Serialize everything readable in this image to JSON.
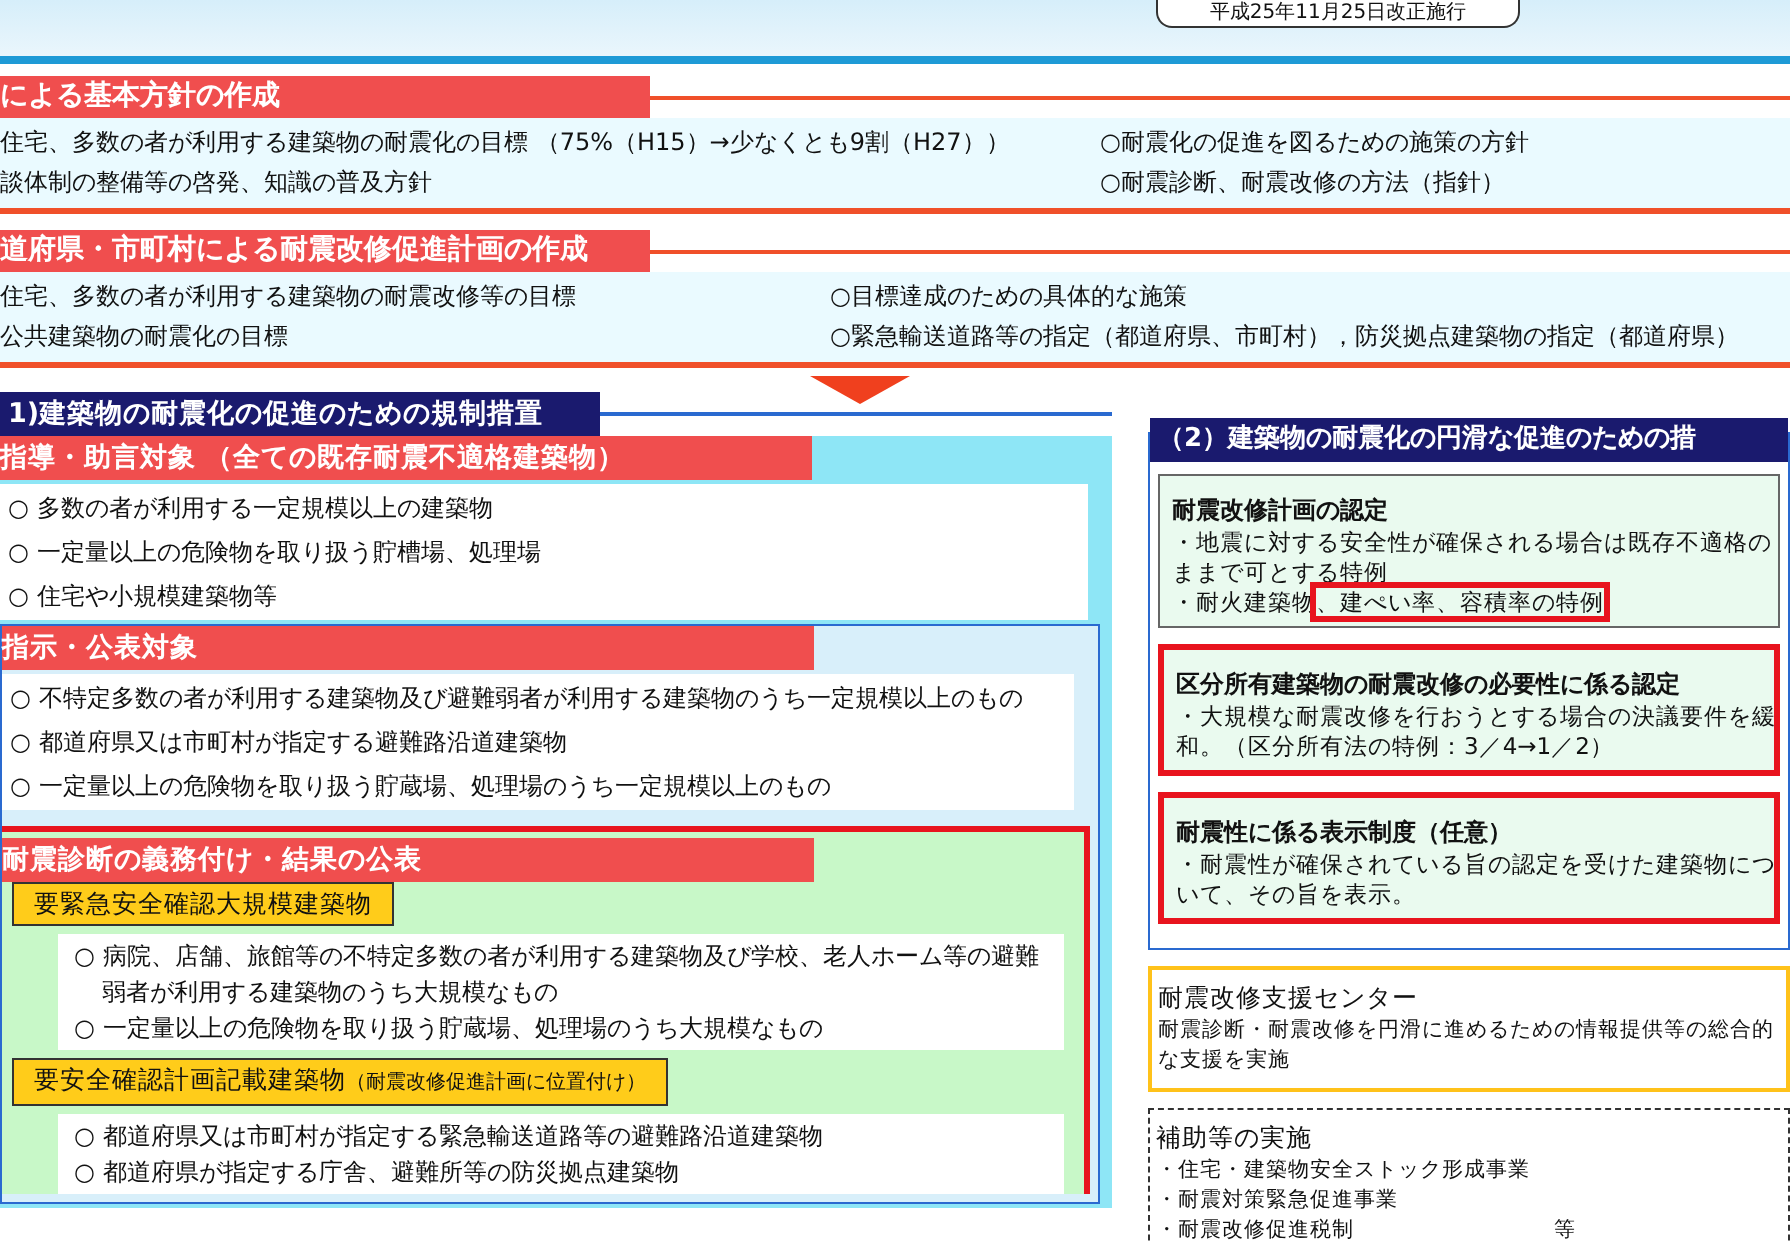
{
  "header": {
    "badge": "平成25年11月25日改正施行"
  },
  "plans": [
    {
      "title": "による基本方針の作成",
      "rows": [
        {
          "left": "住宅、多数の者が利用する建築物の耐震化の目標 （75%（H15）→少なくとも9割（H27））",
          "right": "○耐震化の促進を図るための施策の方針"
        },
        {
          "left": "談体制の整備等の啓発、知識の普及方針",
          "right": "○耐震診断、耐震改修の方法（指針）"
        }
      ]
    },
    {
      "title": "道府県・市町村による耐震改修促進計画の作成",
      "rows": [
        {
          "left": "住宅、多数の者が利用する建築物の耐震改修等の目標",
          "right": "○目標達成のための具体的な施策"
        },
        {
          "left": "公共建築物の耐震化の目標",
          "right": "○緊急輸送道路等の指定（都道府県、市町村），防災拠点建築物の指定（都道府県）"
        }
      ]
    }
  ],
  "regulation": {
    "title": "1)建築物の耐震化の促進のための規制措置",
    "groups": [
      {
        "title": "指導・助言対象 （全ての既存耐震不適格建築物）",
        "items": [
          "○ 多数の者が利用する一定規模以上の建築物",
          "○ 一定量以上の危険物を取り扱う貯槽場、処理場",
          "○ 住宅や小規模建築物等"
        ]
      },
      {
        "title": "指示・公表対象",
        "items": [
          "○ 不特定多数の者が利用する建築物及び避難弱者が利用する建築物のうち一定規模以上のもの",
          "○ 都道府県又は市町村が指定する避難路沿道建築物",
          "○ 一定量以上の危険物を取り扱う貯蔵場、処理場のうち一定規模以上のもの"
        ]
      },
      {
        "title": "耐震診断の義務付け・結果の公表",
        "subgroups": [
          {
            "label": "要緊急安全確認大規模建築物",
            "items": [
              "○ 病院、店舗、旅館等の不特定多数の者が利用する建築物及び学校、老人ホーム等の避難弱者が利用する建築物のうち大規模なもの",
              "○ 一定量以上の危険物を取り扱う貯蔵場、処理場のうち大規模なもの"
            ]
          },
          {
            "label": "要安全確認計画記載建築物",
            "note": "（耐震改修促進計画に位置付け）",
            "items": [
              "○ 都道府県又は市町村が指定する緊急輸送道路等の避難路沿道建築物",
              "○ 都道府県が指定する庁舎、避難所等の防災拠点建築物"
            ]
          }
        ]
      }
    ]
  },
  "promotion": {
    "title": "（2）建築物の耐震化の円滑な促進のための措",
    "boxes": [
      {
        "kind": "plain",
        "heading": "耐震改修計画の認定",
        "lines": [
          [
            {
              "text": "・地震に対する安全性が確保される場合は既存不適格の",
              "highlighted": false
            }
          ],
          [
            {
              "text": "ままで可とする特例",
              "highlighted": false
            }
          ],
          [
            {
              "text": "・耐火建築物",
              "highlighted": false
            },
            {
              "text": "、建ぺい率、容積率の特例",
              "highlighted": true
            }
          ]
        ]
      },
      {
        "kind": "alert",
        "heading": "区分所有建築物の耐震改修の必要性に係る認定",
        "lines": [
          [
            {
              "text": "・大規模な耐震改修を行おうとする場合の決議要件を緩",
              "highlighted": false
            }
          ],
          [
            {
              "text": "和。（区分所有法の特例：3／4→1／2）",
              "highlighted": false
            }
          ]
        ]
      },
      {
        "kind": "alert",
        "heading": "耐震性に係る表示制度（任意）",
        "lines": [
          [
            {
              "text": "・耐震性が確保されている旨の認定を受けた建築物につ",
              "highlighted": false
            }
          ],
          [
            {
              "text": "いて、その旨を表示。",
              "highlighted": false
            }
          ]
        ]
      }
    ]
  },
  "extras": [
    {
      "kind": "center",
      "heading": "耐震改修支援センター",
      "lines": [
        "耐震診断・耐震改修を円滑に進めるための情報提供等の総合的",
        "な支援を実施"
      ]
    },
    {
      "kind": "dashed",
      "heading": "補助等の実施",
      "lines": [
        "・住宅・建築物安全ストック形成事業",
        "・耐震対策緊急促進事業",
        "・耐震改修促進税制"
      ],
      "suffix": "等"
    }
  ]
}
